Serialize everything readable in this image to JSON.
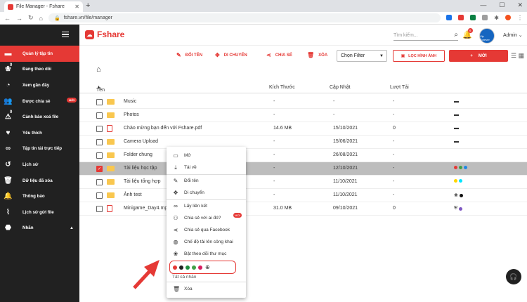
{
  "browser": {
    "tab_title": "File Manager - Fshare",
    "url": "fshare.vn/file/manager"
  },
  "colors": {
    "brand": "#e53935",
    "sidebar": "#212121"
  },
  "sidebar": {
    "items": [
      {
        "label": "Quản lý tập tin",
        "icon": "folder-icon",
        "active": true
      },
      {
        "label": "Đang theo dõi",
        "icon": "paw-icon",
        "sup": "0"
      },
      {
        "label": "Xem gần đây",
        "icon": "clock-icon"
      },
      {
        "label": "Được chia sẻ",
        "icon": "people-icon",
        "badge": "MỚI"
      },
      {
        "label": "Cảnh báo xoá file",
        "icon": "warning-icon",
        "sup": "0"
      },
      {
        "label": "Yêu thích",
        "icon": "heart-icon"
      },
      {
        "label": "Tập tin tải trực tiếp",
        "icon": "link-icon"
      },
      {
        "label": "Lịch sử",
        "icon": "history-icon"
      },
      {
        "label": "Dữ liệu đã xóa",
        "icon": "trash-icon"
      },
      {
        "label": "Thông báo",
        "icon": "bell-icon"
      },
      {
        "label": "Lịch sử gửi file",
        "icon": "attach-icon"
      },
      {
        "label": "Nhãn",
        "icon": "tag-icon"
      }
    ]
  },
  "header": {
    "brand": "Fshare",
    "search_placeholder": "Tìm kiếm...",
    "notif_count": "6",
    "avatar_label": "Vip Forever",
    "user": "Admin"
  },
  "toolbar": {
    "rename": "ĐỔI TÊN",
    "move": "DI CHUYỂN",
    "share": "CHIA SẺ",
    "delete": "XÓA",
    "filter": "Chọn Filter",
    "image_filter": "LỌC HÌNH ẢNH",
    "new": "MỚI"
  },
  "columns": {
    "name": "Tên",
    "size": "Kích Thước",
    "updated": "Cập Nhật",
    "downloads": "Lượt Tải"
  },
  "rows": [
    {
      "name": "Music",
      "size": "-",
      "date": "-",
      "dl": "-",
      "type": "folder"
    },
    {
      "name": "Photos",
      "size": "-",
      "date": "-",
      "dl": "-",
      "type": "folder"
    },
    {
      "name": "Chào mừng bạn đến với Fshare.pdf",
      "size": "14.6 MB",
      "date": "15/10/2021",
      "dl": "0",
      "type": "pdf"
    },
    {
      "name": "Camera Upload",
      "size": "-",
      "date": "15/06/2021",
      "dl": "-",
      "type": "folder"
    },
    {
      "name": "Folder chung",
      "size": "-",
      "date": "26/08/2021",
      "dl": "-",
      "type": "folder"
    },
    {
      "name": "Tài liệu học tập",
      "size": "-",
      "date": "12/10/2021",
      "dl": "-",
      "type": "folder",
      "selected": true
    },
    {
      "name": "Tài liệu tổng hợp",
      "size": "-",
      "date": "11/10/2021",
      "dl": "-",
      "type": "folder"
    },
    {
      "name": "Ảnh test",
      "size": "-",
      "date": "11/10/2021",
      "dl": "-",
      "type": "folder"
    },
    {
      "name": "Minigame_Day4.mp4",
      "size": "31.0 MB",
      "date": "09/10/2021",
      "dl": "0",
      "type": "pdf"
    }
  ],
  "menu": {
    "items": [
      {
        "label": "Mở",
        "icon": "open-icon"
      },
      {
        "label": "Tải về",
        "icon": "download-icon"
      },
      {
        "label": "Đổi tên",
        "icon": "pencil-icon"
      },
      {
        "label": "Di chuyển",
        "icon": "move-icon"
      },
      {
        "label": "Lấy liên kết",
        "icon": "link-icon"
      },
      {
        "label": "Chia sẻ với ai đó?",
        "icon": "person-add-icon",
        "badge": "MỚI"
      },
      {
        "label": "Chia sẻ qua Facebook",
        "icon": "share-icon"
      },
      {
        "label": "Chế độ tải lên công khai",
        "icon": "globe-icon"
      },
      {
        "label": "Bật theo dõi thư mục",
        "icon": "paw-icon"
      }
    ],
    "label_colors": [
      "#e53935",
      "#212121",
      "#1e8e3e",
      "#43a047",
      "#d81b60"
    ],
    "all_labels": "Tất cả nhãn",
    "delete": "Xóa"
  }
}
